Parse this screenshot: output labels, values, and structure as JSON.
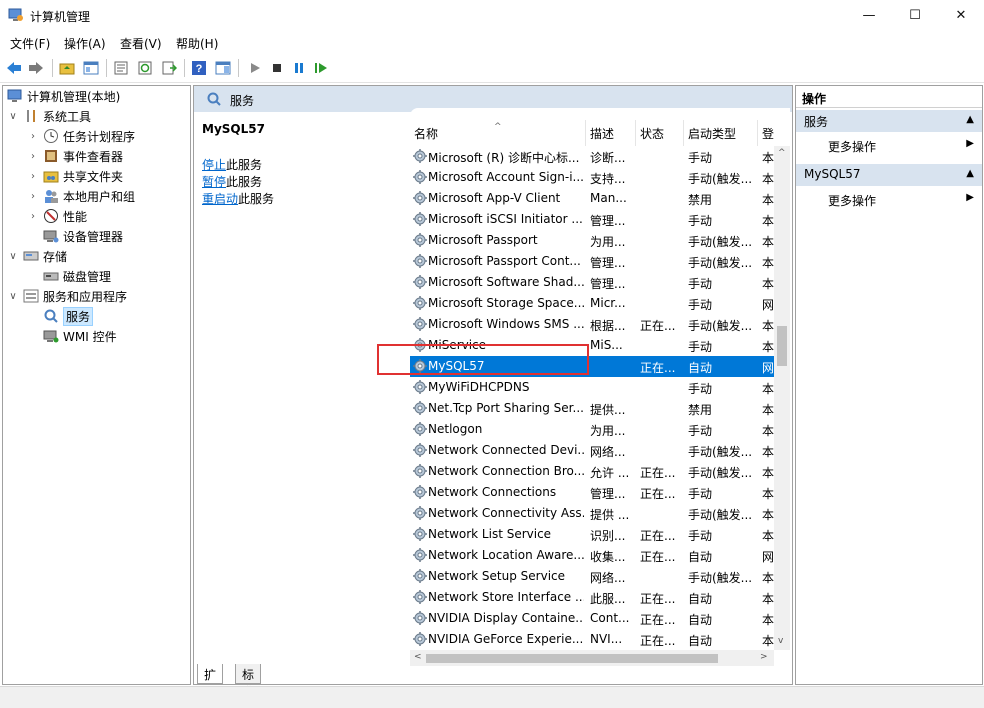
{
  "window": {
    "title": "计算机管理",
    "min": "—",
    "max": "☐",
    "close": "✕"
  },
  "menu": [
    "文件(F)",
    "操作(A)",
    "查看(V)",
    "帮助(H)"
  ],
  "tree": {
    "root": "计算机管理(本地)",
    "system_tools": "系统工具",
    "task_scheduler": "任务计划程序",
    "event_viewer": "事件查看器",
    "shared_folders": "共享文件夹",
    "local_users": "本地用户和组",
    "performance": "性能",
    "device_manager": "设备管理器",
    "storage": "存储",
    "disk_mgmt": "磁盘管理",
    "services_apps": "服务和应用程序",
    "services": "服务",
    "wmi": "WMI 控件"
  },
  "center": {
    "header": "服务",
    "selected_service": "MySQL57",
    "actions": [
      {
        "link": "停止",
        "rest": "此服务"
      },
      {
        "link": "暂停",
        "rest": "此服务"
      },
      {
        "link": "重启动",
        "rest": "此服务"
      }
    ]
  },
  "columns": {
    "name": "名称",
    "desc": "描述",
    "status": "状态",
    "startup": "启动类型",
    "logon": "登"
  },
  "services": [
    {
      "name": "Microsoft (R) 诊断中心标...",
      "desc": "诊断...",
      "status": "",
      "startup": "手动",
      "logon": "本"
    },
    {
      "name": "Microsoft Account Sign-i...",
      "desc": "支持...",
      "status": "",
      "startup": "手动(触发...",
      "logon": "本"
    },
    {
      "name": "Microsoft App-V Client",
      "desc": "Man...",
      "status": "",
      "startup": "禁用",
      "logon": "本"
    },
    {
      "name": "Microsoft iSCSI Initiator ...",
      "desc": "管理...",
      "status": "",
      "startup": "手动",
      "logon": "本"
    },
    {
      "name": "Microsoft Passport",
      "desc": "为用...",
      "status": "",
      "startup": "手动(触发...",
      "logon": "本"
    },
    {
      "name": "Microsoft Passport Cont...",
      "desc": "管理...",
      "status": "",
      "startup": "手动(触发...",
      "logon": "本"
    },
    {
      "name": "Microsoft Software Shad...",
      "desc": "管理...",
      "status": "",
      "startup": "手动",
      "logon": "本"
    },
    {
      "name": "Microsoft Storage Space...",
      "desc": "Micr...",
      "status": "",
      "startup": "手动",
      "logon": "网"
    },
    {
      "name": "Microsoft Windows SMS ...",
      "desc": "根据...",
      "status": "正在...",
      "startup": "手动(触发...",
      "logon": "本"
    },
    {
      "name": "MiService",
      "desc": "MiS...",
      "status": "",
      "startup": "手动",
      "logon": "本"
    },
    {
      "name": "MySQL57",
      "desc": "",
      "status": "正在...",
      "startup": "自动",
      "logon": "网",
      "selected": true
    },
    {
      "name": "MyWiFiDHCPDNS",
      "desc": "",
      "status": "",
      "startup": "手动",
      "logon": "本"
    },
    {
      "name": "Net.Tcp Port Sharing Ser...",
      "desc": "提供...",
      "status": "",
      "startup": "禁用",
      "logon": "本"
    },
    {
      "name": "Netlogon",
      "desc": "为用...",
      "status": "",
      "startup": "手动",
      "logon": "本"
    },
    {
      "name": "Network Connected Devi...",
      "desc": "网络...",
      "status": "",
      "startup": "手动(触发...",
      "logon": "本"
    },
    {
      "name": "Network Connection Bro...",
      "desc": "允许 ...",
      "status": "正在...",
      "startup": "手动(触发...",
      "logon": "本"
    },
    {
      "name": "Network Connections",
      "desc": "管理...",
      "status": "正在...",
      "startup": "手动",
      "logon": "本"
    },
    {
      "name": "Network Connectivity Ass...",
      "desc": "提供 ...",
      "status": "",
      "startup": "手动(触发...",
      "logon": "本"
    },
    {
      "name": "Network List Service",
      "desc": "识别...",
      "status": "正在...",
      "startup": "手动",
      "logon": "本"
    },
    {
      "name": "Network Location Aware...",
      "desc": "收集...",
      "status": "正在...",
      "startup": "自动",
      "logon": "网"
    },
    {
      "name": "Network Setup Service",
      "desc": "网络...",
      "status": "",
      "startup": "手动(触发...",
      "logon": "本"
    },
    {
      "name": "Network Store Interface ...",
      "desc": "此服...",
      "status": "正在...",
      "startup": "自动",
      "logon": "本"
    },
    {
      "name": "NVIDIA Display Containe...",
      "desc": "Cont...",
      "status": "正在...",
      "startup": "自动",
      "logon": "本"
    },
    {
      "name": "NVIDIA GeForce Experie...",
      "desc": "NVI...",
      "status": "正在...",
      "startup": "自动",
      "logon": "本"
    }
  ],
  "tabs": {
    "extended": "扩展",
    "standard": "标准"
  },
  "actions_pane": {
    "title": "操作",
    "section1": "服务",
    "more1": "更多操作",
    "section2": "MySQL57",
    "more2": "更多操作"
  },
  "colors": {
    "selection": "#0078d7",
    "header_bg": "#d8e3ef",
    "highlight_box": "#e03131",
    "link": "#0066cc"
  }
}
